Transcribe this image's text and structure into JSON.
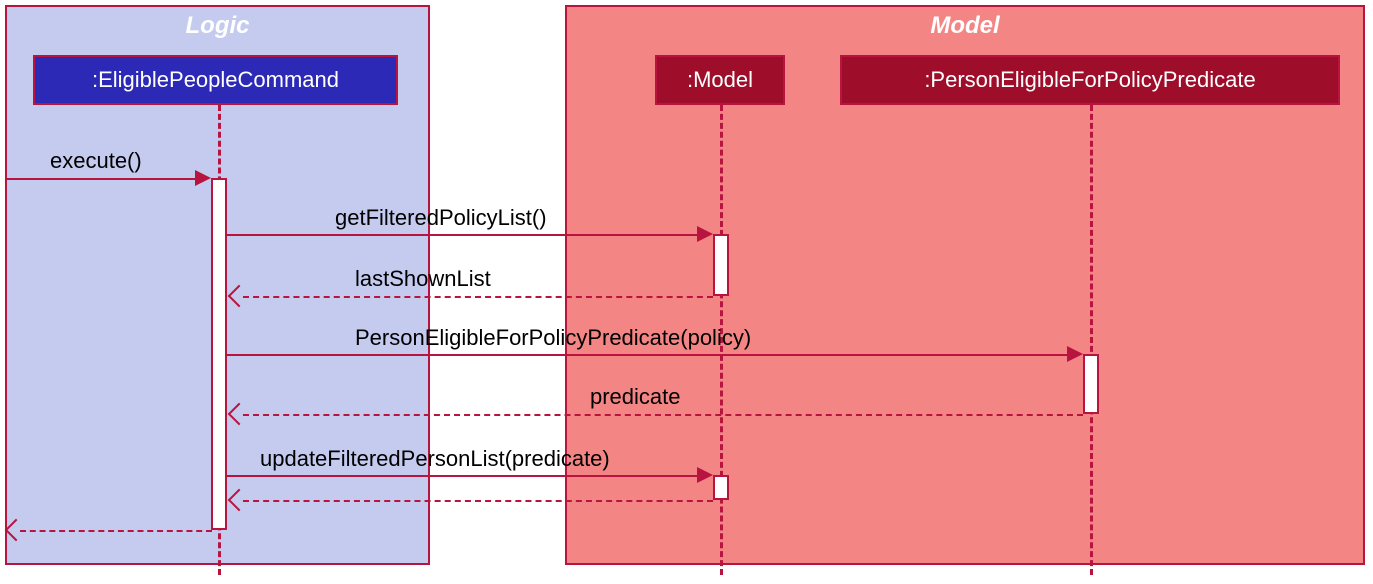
{
  "frames": {
    "logic": {
      "label": "Logic",
      "bg": "#c5cbee",
      "border": "#b71540",
      "label_color": "#ffffff"
    },
    "model": {
      "label": "Model",
      "bg": "#f48585",
      "border": "#b71540",
      "label_color": "#ffffff"
    }
  },
  "participants": {
    "eligible": {
      "label": ":EligiblePeopleCommand",
      "bg": "#2c29b7",
      "border": "#b71540",
      "color": "#ffffff"
    },
    "model": {
      "label": ":Model",
      "bg": "#a0102e",
      "border": "#b71540",
      "color": "#ffffff"
    },
    "predicate": {
      "label": ":PersonEligibleForPolicyPredicate",
      "bg": "#a0102e",
      "border": "#b71540",
      "color": "#ffffff"
    }
  },
  "messages": {
    "execute": "execute()",
    "getFiltered": "getFilteredPolicyList()",
    "lastShown": "lastShownList",
    "personEligible": "PersonEligibleForPolicyPredicate(policy)",
    "predicate_ret": "predicate",
    "updateFiltered": "updateFilteredPersonList(predicate)"
  },
  "colors": {
    "arrow_logic": "#b71540",
    "arrow_model": "#b71540",
    "lifeline_logic": "#b71540",
    "lifeline_model": "#b71540"
  }
}
